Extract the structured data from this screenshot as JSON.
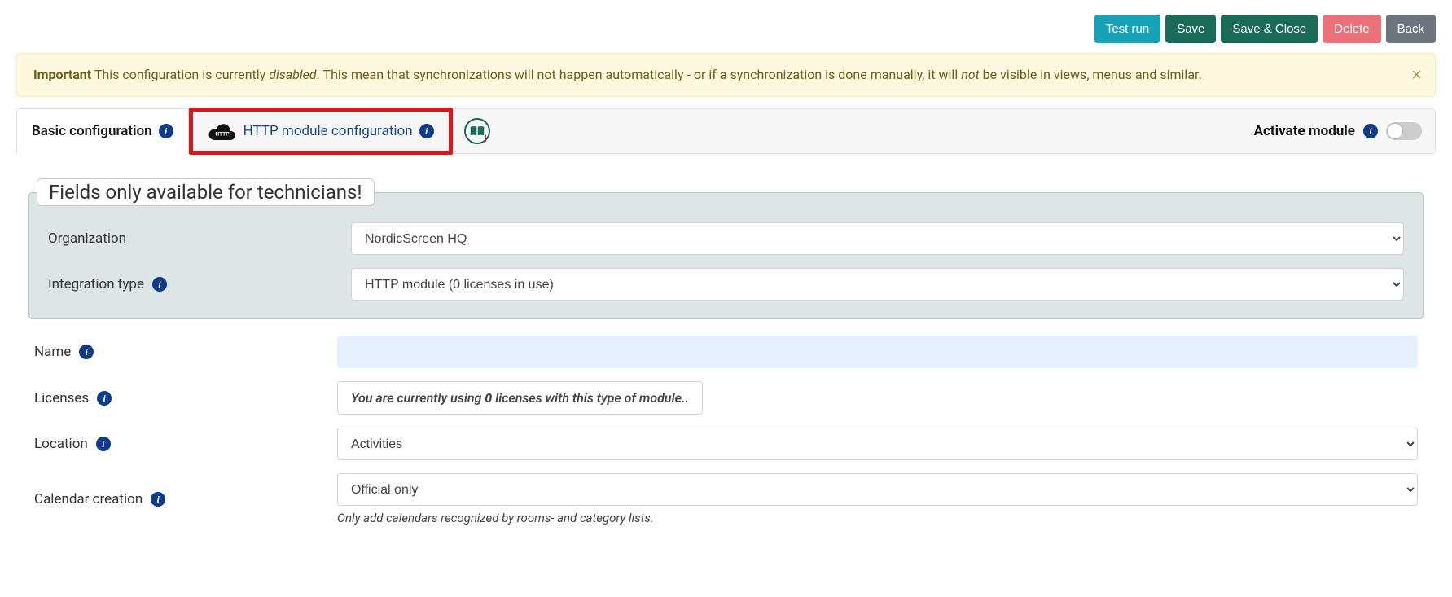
{
  "toolbar": {
    "test_run": "Test run",
    "save": "Save",
    "save_close": "Save & Close",
    "delete": "Delete",
    "back": "Back"
  },
  "alert": {
    "strong": "Important",
    "pre": " This configuration is currently ",
    "disabled_word": "disabled",
    "mid": ". This mean that synchronizations will not happen automatically - or if a synchronization is done manually, it will ",
    "not_word": "not",
    "post": " be visible in views, menus and similar.",
    "close": "×"
  },
  "tabs": {
    "basic": "Basic configuration",
    "http": "HTTP module configuration"
  },
  "activate": {
    "label": "Activate module"
  },
  "fieldset": {
    "legend": "Fields only available for technicians!"
  },
  "form": {
    "organization": {
      "label": "Organization",
      "value": "NordicScreen HQ"
    },
    "integration_type": {
      "label": "Integration type",
      "value": "HTTP module (0 licenses in use)"
    },
    "name": {
      "label": "Name",
      "value": ""
    },
    "licenses": {
      "label": "Licenses",
      "text_pre": "You are currently using ",
      "count": "0",
      "text_post": " licenses with this type of module.."
    },
    "location": {
      "label": "Location",
      "value": "Activities"
    },
    "calendar_creation": {
      "label": "Calendar creation",
      "value": "Official only",
      "help": "Only add calendars recognized by rooms- and category lists."
    }
  }
}
